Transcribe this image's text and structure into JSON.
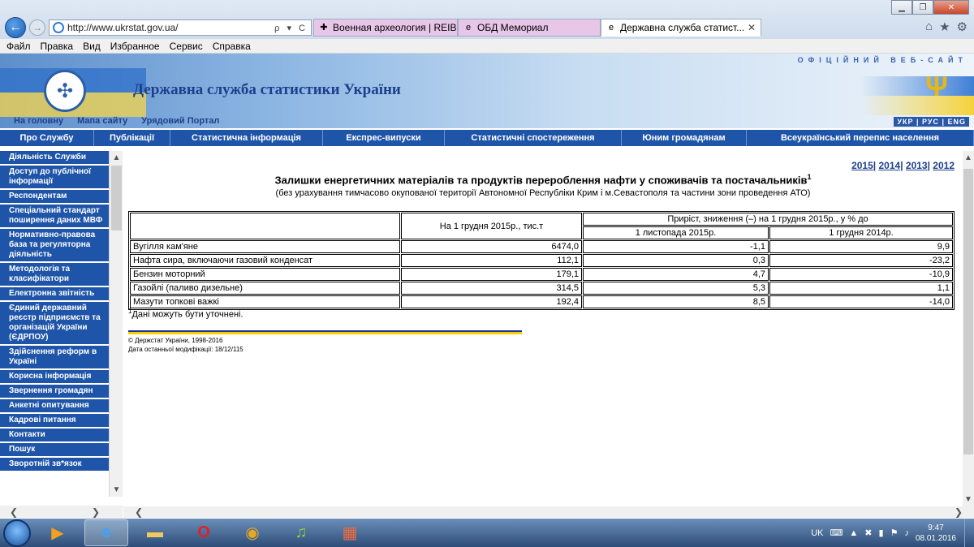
{
  "browser": {
    "url": "http://www.ukrstat.gov.ua/",
    "address_tools": "ρ ▾ C",
    "tabs": [
      {
        "title": "Военная археология | REIBER..."
      },
      {
        "title": "ОБД Мемориал"
      },
      {
        "title": "Державна служба статист...",
        "close": "✕"
      }
    ],
    "menu": [
      "Файл",
      "Правка",
      "Вид",
      "Избранное",
      "Сервис",
      "Справка"
    ],
    "window_controls": {
      "minimize": "▁",
      "maximize": "❐",
      "close": "✕"
    },
    "toolbar_icons": {
      "home": "⌂",
      "favorites": "★",
      "tools": "⚙"
    }
  },
  "site": {
    "title": "Державна служба статистики України",
    "official": "ОФІЦІЙНИЙ ВЕБ-САЙТ",
    "languages": "УКР | РУС | ENG",
    "top_links": [
      "На головну",
      "Мапа сайту",
      "Урядовий Портал"
    ],
    "main_nav": [
      "Про Службу",
      "Публікації",
      "Статистична інформація",
      "Експрес-випуски",
      "Статистичні спостереження",
      "Юним громадянам",
      "Всеукраїнський перепис населення"
    ]
  },
  "sidebar": [
    "Діяльність Служби",
    "Доступ до публічної інформації",
    "Респондентам",
    "Спеціальний стандарт поширення даних МВФ",
    "Нормативно-правова база та регуляторна діяльність",
    "Методологія та класифікатори",
    "Електронна звітність",
    "Єдиний державний реєстр підприємств та організацій України (ЄДРПОУ)",
    "Здійснення реформ в Україні",
    "Корисна інформація",
    "Звернення громадян",
    "Анкетні опитування",
    "Кадрові питання",
    "Контакти",
    "Пошук",
    "Зворотній зв*язок"
  ],
  "report": {
    "years": [
      "2015",
      "2014",
      "2013",
      "2012"
    ],
    "year_sep": "|",
    "title": "Залишки енергетичних матеріалів та продуктів перероблення нафти у споживачів та постачальників",
    "title_sup": "1",
    "subtitle": "(без урахування тимчасово окупованої території Автономної Республіки Крим і м.Севастополя та частини зони проведення АТО)",
    "headers": {
      "col1": "На 1 грудня 2015р., тис.т",
      "group": "Приріст, зниження (–) на 1 грудня 2015р., у % до",
      "sub1": "1 листопада 2015р.",
      "sub2": "1 грудня 2014р."
    },
    "rows": [
      {
        "name": "Вугілля кам'яне",
        "v1": "6474,0",
        "v2": "-1,1",
        "v3": "9,9"
      },
      {
        "name": "Нафта сира, включаючи газовий конденсат",
        "v1": "112,1",
        "v2": "0,3",
        "v3": "-23,2"
      },
      {
        "name": "Бензин моторний",
        "v1": "179,1",
        "v2": "4,7",
        "v3": "-10,9"
      },
      {
        "name": "Газойлі (паливо дизельне)",
        "v1": "314,5",
        "v2": "5,3",
        "v3": "1,1"
      },
      {
        "name": "Мазути топкові важкі",
        "v1": "192,4",
        "v2": "8,5",
        "v3": "-14,0"
      }
    ],
    "footnote_sup": "1",
    "footnote": "Дані можуть бути уточнені.",
    "copyright": "© Держстат України, 1998-2016",
    "modified": "Дата останньої модифікації: 18/12/115"
  },
  "taskbar": {
    "language": "UK",
    "time": "9:47",
    "date": "08.01.2016"
  }
}
